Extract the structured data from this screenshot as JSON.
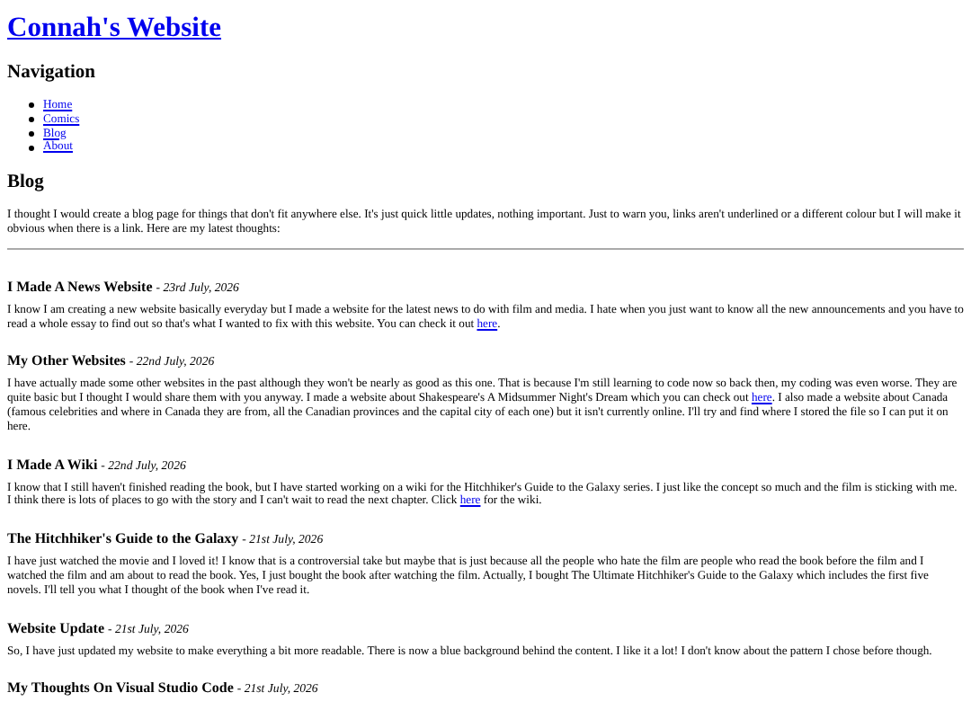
{
  "site_title": "Connah's Website",
  "navigation": {
    "heading": "Navigation",
    "links": [
      "Home",
      "Comics",
      "Blog",
      "About"
    ]
  },
  "blog": {
    "heading": "Blog",
    "intro": "I thought I would create a blog page for things that don't fit anywhere else. It's just quick little updates, nothing important. Just to warn you, links aren't underlined or a different colour but I will make it obvious when there is a link. Here are my latest thoughts:"
  },
  "posts": [
    {
      "title": "I Made A News Website",
      "date": "- 23rd July, 2026",
      "before": "I know I am creating a new website basically everyday but I made a website for the latest news to do with film and media. I hate when you just want to know all the new announcements and you have to read a whole essay to find out so that's what I wanted to fix with this website. You can check it out ",
      "link": "here",
      "after": "."
    },
    {
      "title": "My Other Websites",
      "date": "- 22nd July, 2026",
      "before": "I have actually made some other websites in the past although they won't be nearly as good as this one. That is because I'm still learning to code now so back then, my coding was even worse. They are quite basic but I thought I would share them with you anyway. I made a website about Shakespeare's A Midsummer Night's Dream which you can check out ",
      "link": "here",
      "after": ". I also made a website about Canada (famous celebrities and where in Canada they are from, all the Canadian provinces and the capital city of each one) but it isn't currently online. I'll try and find where I stored the file so I can put it on here."
    },
    {
      "title": "I Made A Wiki",
      "date": "- 22nd July, 2026",
      "before": "I know that I still haven't finished reading the book, but I have started working on a wiki for the Hitchhiker's Guide to the Galaxy series. I just like the concept so much and the film is sticking with me. I think there is lots of places to go with the story and I can't wait to read the next chapter. Click ",
      "link": "here",
      "after": " for the wiki."
    },
    {
      "title": "The Hitchhiker's Guide to the Galaxy",
      "date": "- 21st July, 2026",
      "before": "I have just watched the movie and I loved it! I know that is a controversial take but maybe that is just because all the people who hate the film are people who read the book before the film and I watched the film and am about to read the book. Yes, I just bought the book after watching the film. Actually, I bought The Ultimate Hitchhiker's Guide to the Galaxy which includes the first five novels. I'll tell you what I thought of the book when I've read it."
    },
    {
      "title": "Website Update",
      "date": "- 21st July, 2026",
      "before": "So, I have just updated my website to make everything a bit more readable. There is now a blue background behind the content. I like it a lot! I don't know about the pattern I chose before though."
    },
    {
      "title": "My Thoughts On Visual Studio Code",
      "date": "- 21st July, 2026"
    }
  ]
}
